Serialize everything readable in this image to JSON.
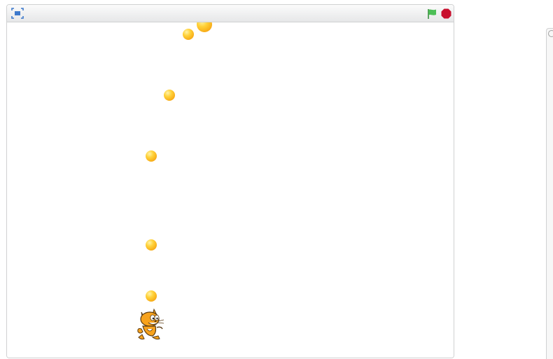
{
  "stage": {
    "controls": {
      "fullscreen_icon": "fullscreen-icon",
      "green_flag_icon": "green-flag-icon",
      "stop_icon": "stop-sign-icon"
    },
    "colors": {
      "flag": "#4cbf56",
      "stop": "#c8102e",
      "fullscreen": "#3d79cc",
      "ball": "#f6a612"
    },
    "sprites": [
      {
        "name": "ball",
        "count": 6
      },
      {
        "name": "cat",
        "count": 1
      }
    ]
  },
  "side_panel": {
    "icon": "search-icon"
  }
}
